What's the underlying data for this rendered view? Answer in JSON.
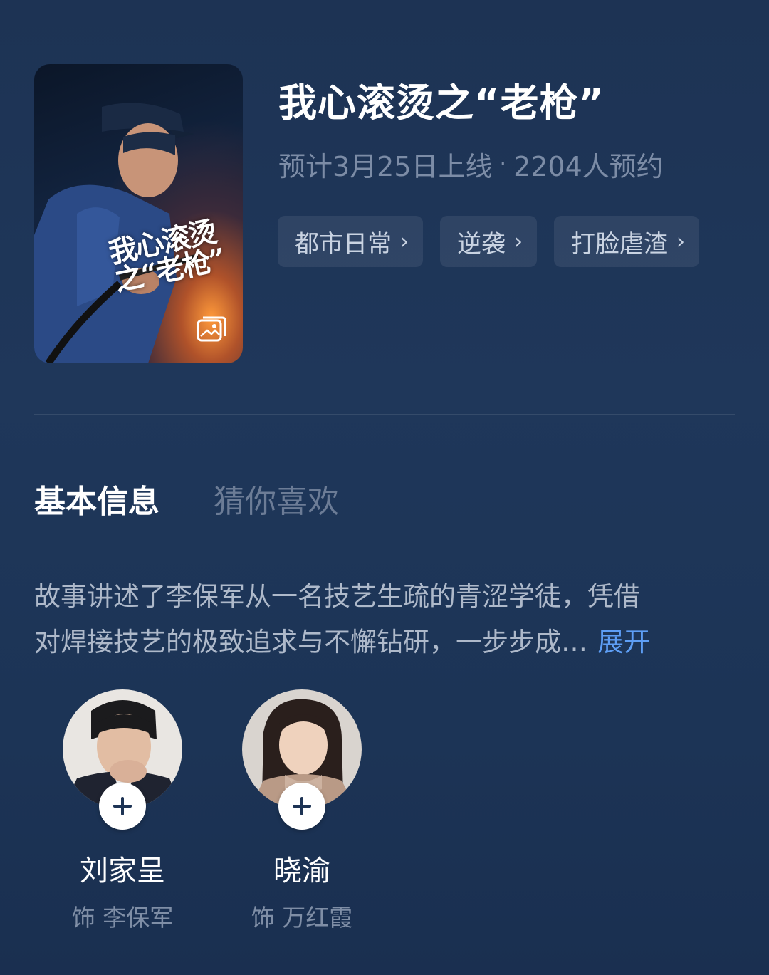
{
  "show": {
    "title": "我心滚烫之“老枪”",
    "release": "预计3月25日上线",
    "separator": "·",
    "reservations": "2204人预约",
    "poster_title_line1": "我心滚烫",
    "poster_title_line2": "之“老枪”"
  },
  "tags": [
    {
      "label": "都市日常",
      "icon": "chevron-right-icon"
    },
    {
      "label": "逆袭",
      "icon": "chevron-right-icon"
    },
    {
      "label": "打脸虐渣",
      "icon": "chevron-right-icon"
    }
  ],
  "tabs": [
    {
      "label": "基本信息",
      "active": true
    },
    {
      "label": "猜你喜欢",
      "active": false
    }
  ],
  "description": {
    "line1": "故事讲述了李保军从一名技艺生疏的青涩学徒，凭借",
    "line2": "对焊接技艺的极致追求与不懈钻研，一步步成…",
    "expand": "展开"
  },
  "cast": [
    {
      "name": "刘家呈",
      "role": "饰 李保军",
      "follow_icon": "plus-icon"
    },
    {
      "name": "晓渝",
      "role": "饰 万红霞",
      "follow_icon": "plus-icon"
    }
  ],
  "colors": {
    "background": "#1f375a",
    "link": "#5e9ef5",
    "muted_text": "#7c8ca6"
  }
}
